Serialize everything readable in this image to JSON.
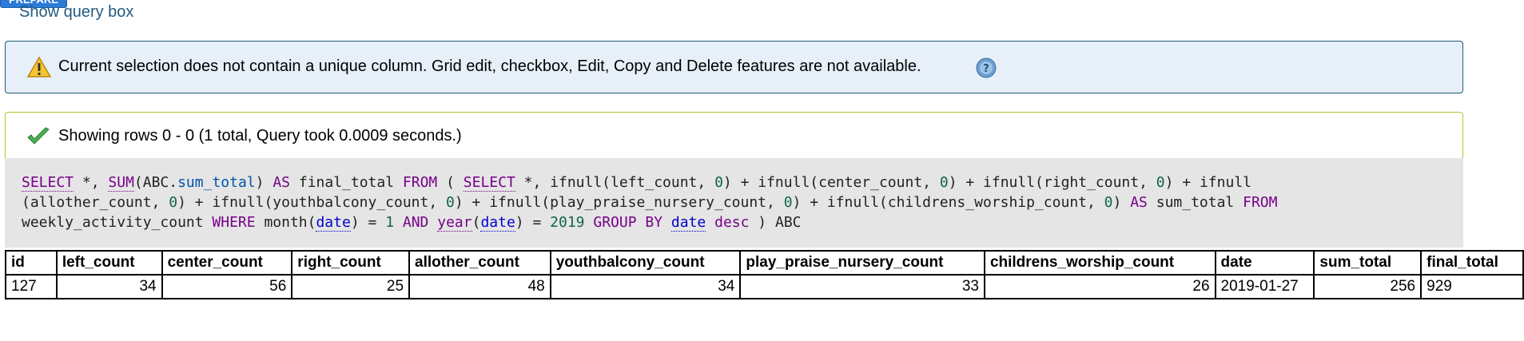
{
  "prepare_label": "PREPARE",
  "show_query_label": "Show query box",
  "notice": {
    "icon": "warning-icon",
    "message": "Current selection does not contain a unique column. Grid edit, checkbox, Edit, Copy and Delete features are not available.",
    "help_icon": "help-icon"
  },
  "success": {
    "icon": "check-icon",
    "message": "Showing rows 0 - 0 (1 total, Query took 0.0009 seconds.)"
  },
  "sql": {
    "line1_parts": [
      "SELECT",
      " *, ",
      "SUM",
      "(ABC.",
      "sum_total",
      ") ",
      "AS",
      " final_total ",
      "FROM",
      " ( ",
      "SELECT",
      " *, ifnull(left_count, ",
      "0",
      ") + ifnull(center_count, ",
      "0",
      ") + ifnull(right_count, ",
      "0",
      ") + ifnull"
    ],
    "line2_parts": [
      "(allother_count, ",
      "0",
      ") + ifnull(youthbalcony_count, ",
      "0",
      ") + ifnull(play_praise_nursery_count, ",
      "0",
      ") + ifnull(childrens_worship_count, ",
      "0",
      ") ",
      "AS",
      " sum_total ",
      "FROM"
    ],
    "line3_parts": [
      "weekly_activity_count ",
      "WHERE",
      " month(",
      "date",
      ") = ",
      "1",
      " ",
      "AND",
      " ",
      "year",
      "(",
      "date",
      ") = ",
      "2019",
      " ",
      "GROUP BY",
      " ",
      "date",
      " ",
      "desc",
      " ) ABC"
    ]
  },
  "table": {
    "headers": [
      "id",
      "left_count",
      "center_count",
      "right_count",
      "allother_count",
      "youthbalcony_count",
      "play_praise_nursery_count",
      "childrens_worship_count",
      "date",
      "sum_total",
      "final_total"
    ],
    "rows": [
      [
        "127",
        "34",
        "56",
        "25",
        "48",
        "34",
        "33",
        "26",
        "2019-01-27",
        "256",
        "929"
      ]
    ]
  },
  "colors": {
    "link": "#235a81",
    "notice_bg": "#e7f0f8",
    "success_border": "#a3d12f",
    "sql_bg": "#e5e5e5"
  }
}
